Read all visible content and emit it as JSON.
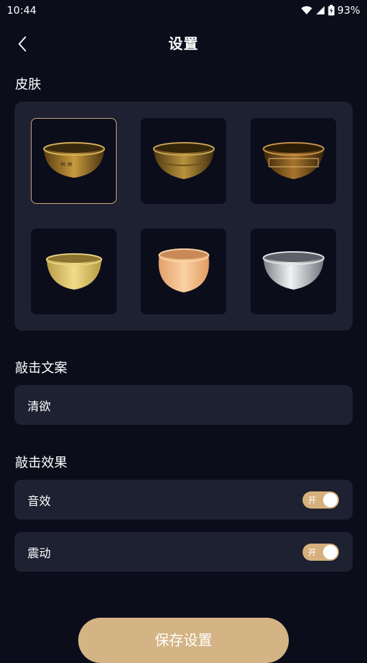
{
  "status_bar": {
    "time": "10:44",
    "battery": "93%"
  },
  "header": {
    "title": "设置"
  },
  "skin": {
    "label": "皮肤",
    "items": [
      {
        "name": "bronze-engraved-bowl",
        "selected": true
      },
      {
        "name": "bronze-relief-bowl",
        "selected": false
      },
      {
        "name": "bronze-script-bowl",
        "selected": false
      },
      {
        "name": "light-gold-bowl",
        "selected": false
      },
      {
        "name": "peach-bowl",
        "selected": false
      },
      {
        "name": "silver-bowl",
        "selected": false
      }
    ]
  },
  "tap_text": {
    "label": "敲击文案",
    "value": "清欲"
  },
  "tap_effect": {
    "label": "敲击效果",
    "sound": {
      "label": "音效",
      "toggle_text": "开",
      "on": true
    },
    "vibration": {
      "label": "震动",
      "toggle_text": "开",
      "on": true
    }
  },
  "save_button": {
    "label": "保存设置"
  },
  "colors": {
    "accent": "#d6b07c",
    "background": "#0b0d1b",
    "card": "#1e2131"
  }
}
